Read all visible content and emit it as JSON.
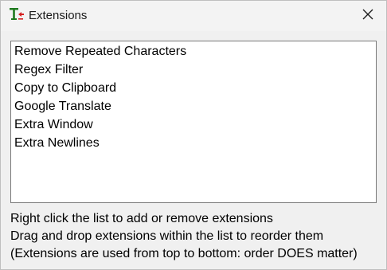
{
  "window": {
    "title": "Extensions",
    "app_icon": "text-cursor-app-icon",
    "close_icon": "close-icon"
  },
  "extensions": [
    {
      "label": "Remove Repeated Characters"
    },
    {
      "label": "Regex Filter"
    },
    {
      "label": "Copy to Clipboard"
    },
    {
      "label": "Google Translate"
    },
    {
      "label": "Extra Window"
    },
    {
      "label": "Extra Newlines"
    }
  ],
  "hints": {
    "line1": "Right click the list to add or remove extensions",
    "line2": "Drag and drop extensions within the list to reorder them",
    "line3": "(Extensions are used from top to bottom: order DOES matter)"
  },
  "colors": {
    "icon_green": "#1f7a1f",
    "icon_red": "#d42020"
  }
}
